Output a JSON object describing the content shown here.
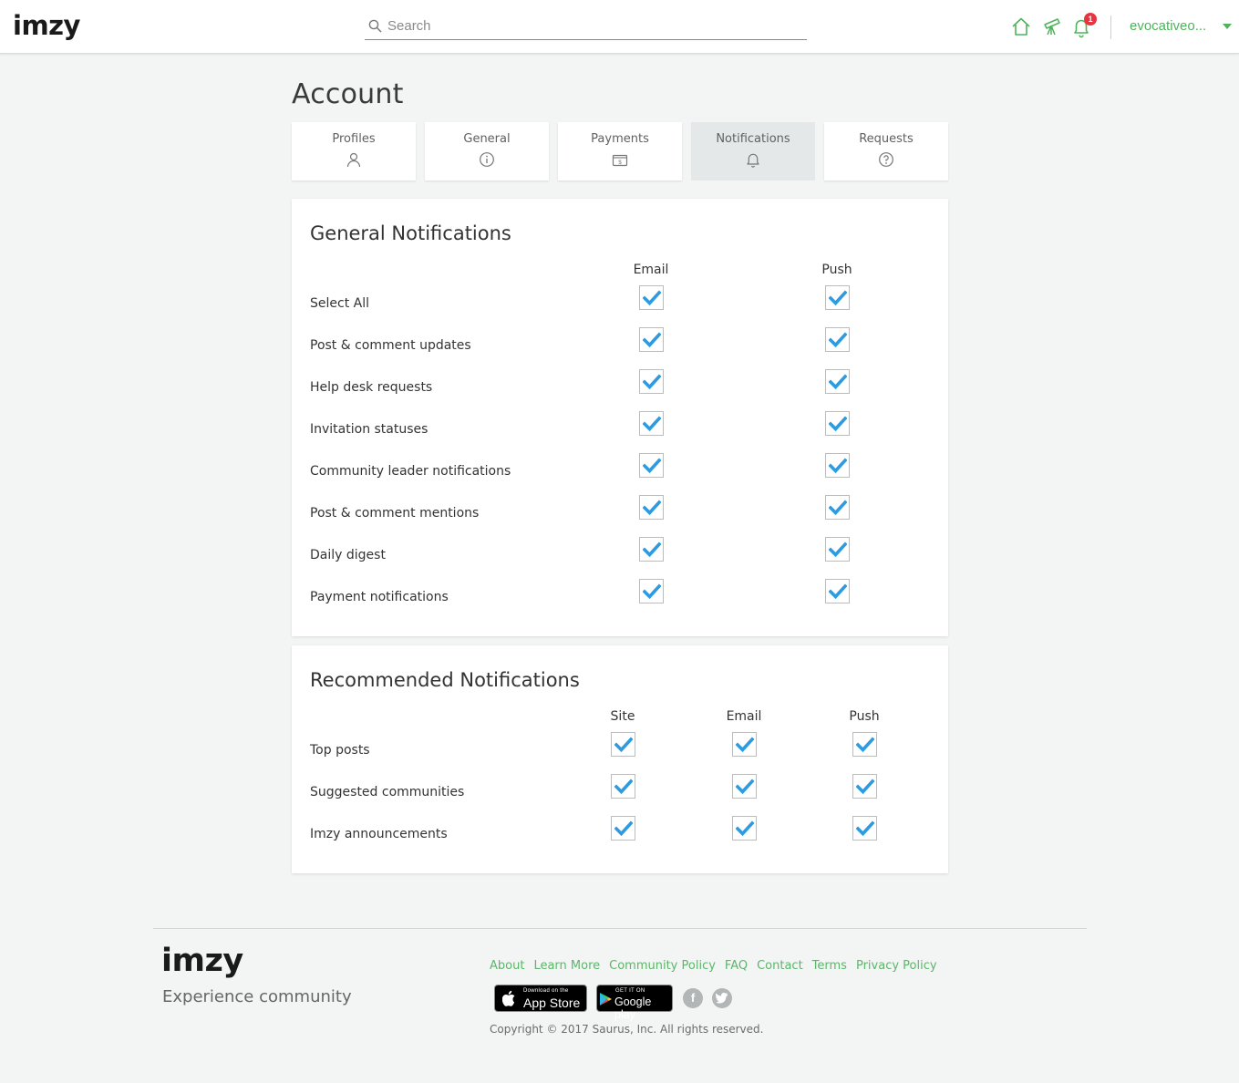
{
  "header": {
    "logo": "imzy",
    "search_placeholder": "Search",
    "notification_count": "1",
    "username": "evocativeo...",
    "icons": [
      "home-icon",
      "telescope-icon",
      "bell-icon"
    ],
    "accent_color": "#4fb35b"
  },
  "page": {
    "title": "Account"
  },
  "tabs": [
    {
      "label": "Profiles",
      "icon": "person-icon",
      "active": false
    },
    {
      "label": "General",
      "icon": "info-icon",
      "active": false
    },
    {
      "label": "Payments",
      "icon": "wallet-icon",
      "active": false
    },
    {
      "label": "Notifications",
      "icon": "bell-icon",
      "active": true
    },
    {
      "label": "Requests",
      "icon": "question-icon",
      "active": false
    }
  ],
  "general_notifications": {
    "title": "General Notifications",
    "columns": [
      "Email",
      "Push"
    ],
    "rows": [
      {
        "label": "Select All",
        "email": true,
        "push": true
      },
      {
        "label": "Post & comment updates",
        "email": true,
        "push": true
      },
      {
        "label": "Help desk requests",
        "email": true,
        "push": true
      },
      {
        "label": "Invitation statuses",
        "email": true,
        "push": true
      },
      {
        "label": "Community leader notifications",
        "email": true,
        "push": true
      },
      {
        "label": "Post & comment mentions",
        "email": true,
        "push": true
      },
      {
        "label": "Daily digest",
        "email": true,
        "push": true
      },
      {
        "label": "Payment notifications",
        "email": true,
        "push": true
      }
    ]
  },
  "recommended_notifications": {
    "title": "Recommended Notifications",
    "columns": [
      "Site",
      "Email",
      "Push"
    ],
    "rows": [
      {
        "label": "Top posts",
        "site": true,
        "email": true,
        "push": true
      },
      {
        "label": "Suggested communities",
        "site": true,
        "email": true,
        "push": true
      },
      {
        "label": "Imzy announcements",
        "site": true,
        "email": true,
        "push": true
      }
    ]
  },
  "checkmark_color": "#2e9be0",
  "footer": {
    "logo": "imzy",
    "tagline": "Experience community",
    "links": [
      "About",
      "Learn More",
      "Community Policy",
      "FAQ",
      "Contact",
      "Terms",
      "Privacy Policy"
    ],
    "app_store": {
      "small": "Download on the",
      "big": "App Store"
    },
    "google_play": {
      "small": "GET IT ON",
      "big": "Google play"
    },
    "social": [
      "facebook-icon",
      "twitter-icon"
    ],
    "copyright": "Copyright © 2017 Saurus, Inc. All rights reserved."
  }
}
